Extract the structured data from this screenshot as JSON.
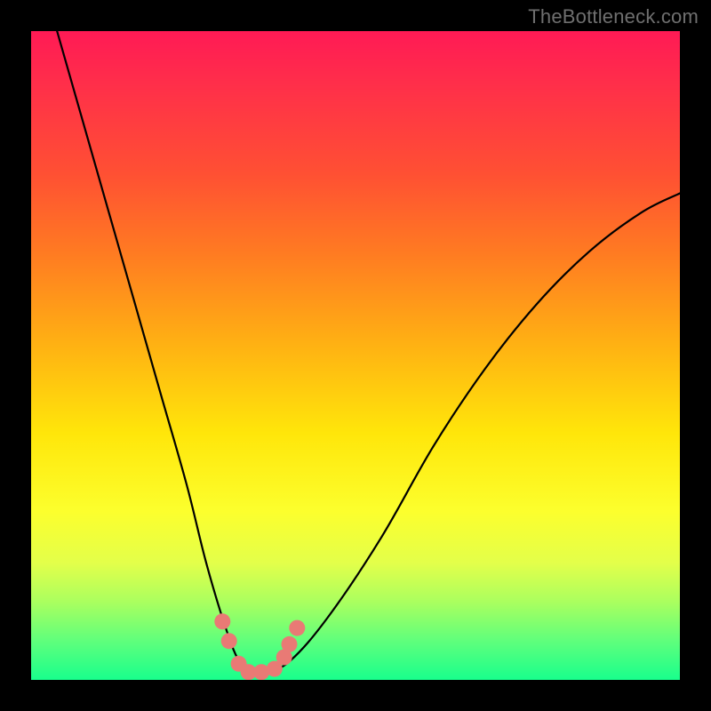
{
  "watermark": "TheBottleneck.com",
  "chart_data": {
    "type": "line",
    "title": "",
    "xlabel": "",
    "ylabel": "",
    "xlim": [
      0,
      100
    ],
    "ylim": [
      0,
      100
    ],
    "series": [
      {
        "name": "bottleneck-curve",
        "x": [
          4,
          8,
          12,
          16,
          20,
          24,
          27,
          30,
          32,
          34,
          36,
          40,
          46,
          54,
          62,
          70,
          78,
          86,
          94,
          100
        ],
        "values": [
          100,
          86,
          72,
          58,
          44,
          30,
          18,
          8,
          3,
          1,
          1,
          3,
          10,
          22,
          36,
          48,
          58,
          66,
          72,
          75
        ]
      }
    ],
    "markers": {
      "name": "bottleneck-zone-markers",
      "color": "#e97a75",
      "points": [
        {
          "x": 29.5,
          "y": 9.0
        },
        {
          "x": 30.5,
          "y": 6.0
        },
        {
          "x": 32.0,
          "y": 2.5
        },
        {
          "x": 33.5,
          "y": 1.2
        },
        {
          "x": 35.5,
          "y": 1.2
        },
        {
          "x": 37.5,
          "y": 1.7
        },
        {
          "x": 39.0,
          "y": 3.5
        },
        {
          "x": 39.8,
          "y": 5.5
        },
        {
          "x": 41.0,
          "y": 8.0
        }
      ]
    },
    "background_gradient": {
      "top": "#ff1a55",
      "mid": "#ffe60a",
      "bottom": "#19ff8c"
    }
  }
}
